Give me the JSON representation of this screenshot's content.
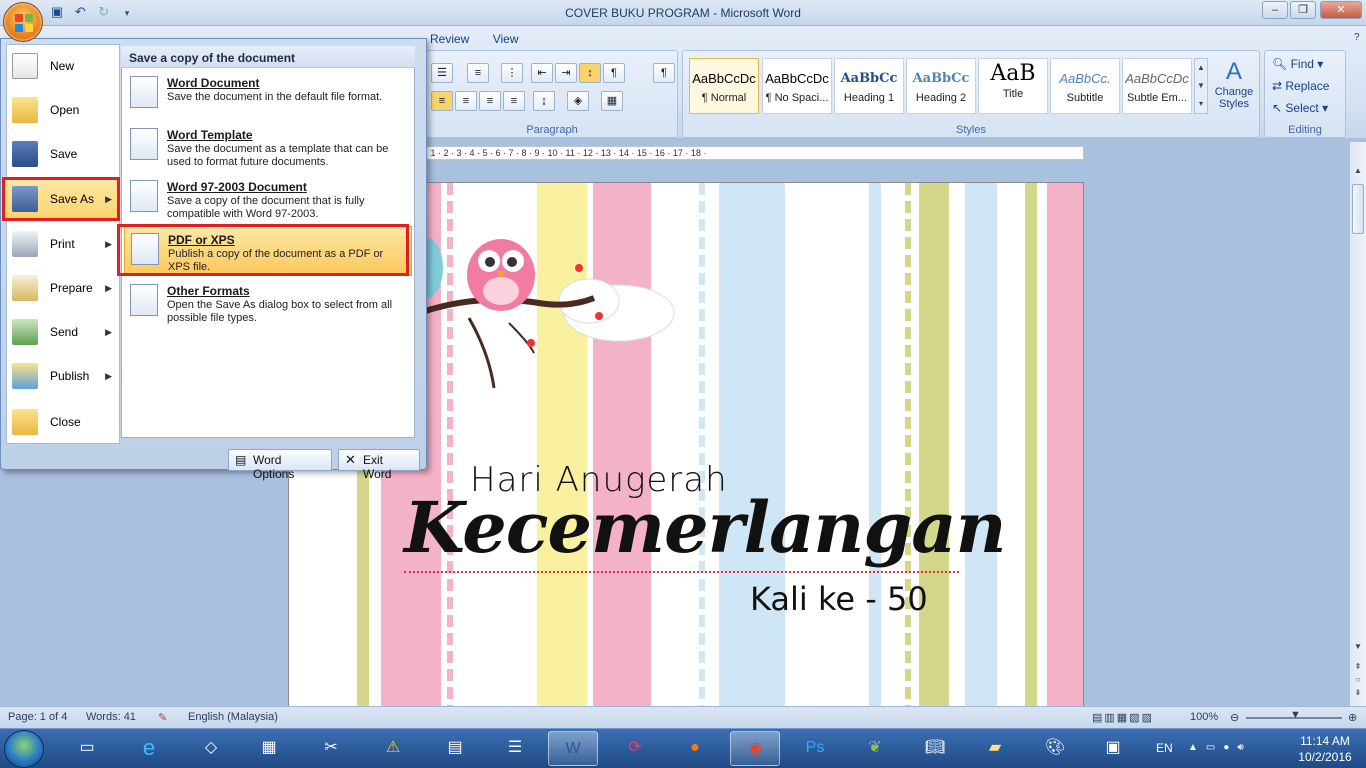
{
  "window": {
    "title": "COVER BUKU PROGRAM - Microsoft Word",
    "min": "–",
    "max": "❐",
    "close": "✕"
  },
  "ribbon": {
    "tabs": [
      "Review",
      "View"
    ],
    "paragraph_label": "Paragraph",
    "styles_label": "Styles",
    "editing_label": "Editing",
    "styles": [
      {
        "preview": "AaBbCcDc",
        "name": "¶ Normal"
      },
      {
        "preview": "AaBbCcDc",
        "name": "¶ No Spaci..."
      },
      {
        "preview": "AaBbCc",
        "name": "Heading 1"
      },
      {
        "preview": "AaBbCc",
        "name": "Heading 2"
      },
      {
        "preview": "AaB",
        "name": "Title"
      },
      {
        "preview": "AaBbCc.",
        "name": "Subtitle"
      },
      {
        "preview": "AaBbCcDc",
        "name": "Subtle Em..."
      }
    ],
    "change_styles": "Change Styles",
    "find": "Find",
    "replace": "Replace",
    "select": "Select"
  },
  "ruler": "· 1 · 2 · 3 · 4 · 5 · 6 · 7 · 8 · 9 · 10 · 11 · 12 · 13 · 14 · 15 · 16 · 17 · 18 ·",
  "menu": {
    "items": [
      "New",
      "Open",
      "Save",
      "Save As",
      "Print",
      "Prepare",
      "Send",
      "Publish",
      "Close"
    ],
    "submenu_title": "Save a copy of the document",
    "options": [
      {
        "title": "Word Document",
        "desc": "Save the document in the default file format."
      },
      {
        "title": "Word Template",
        "desc": "Save the document as a template that can be used to format future documents."
      },
      {
        "title": "Word 97-2003 Document",
        "desc": "Save a copy of the document that is fully compatible with Word 97-2003."
      },
      {
        "title": "PDF or XPS",
        "desc": "Publish a copy of the document as a PDF or XPS file."
      },
      {
        "title": "Other Formats",
        "desc": "Open the Save As dialog box to select from all possible file types."
      }
    ],
    "word_options": "Word Options",
    "exit_word": "Exit Word"
  },
  "document": {
    "line1": "Hari Anugerah",
    "line2": "Kecemerlangan",
    "line3": "Kali ke - 50"
  },
  "status": {
    "page": "Page: 1 of 4",
    "words": "Words: 41",
    "language": "English (Malaysia)",
    "zoom": "100%"
  },
  "taskbar": {
    "lang": "EN",
    "time": "11:14 AM",
    "date": "10/2/2016"
  },
  "colors": {
    "stripe_pink": "#f4b2c9",
    "stripe_yellow": "#f9f0a0",
    "stripe_blue": "#cfe6f6",
    "stripe_green": "#d4d78a",
    "highlight": "#e02020"
  }
}
